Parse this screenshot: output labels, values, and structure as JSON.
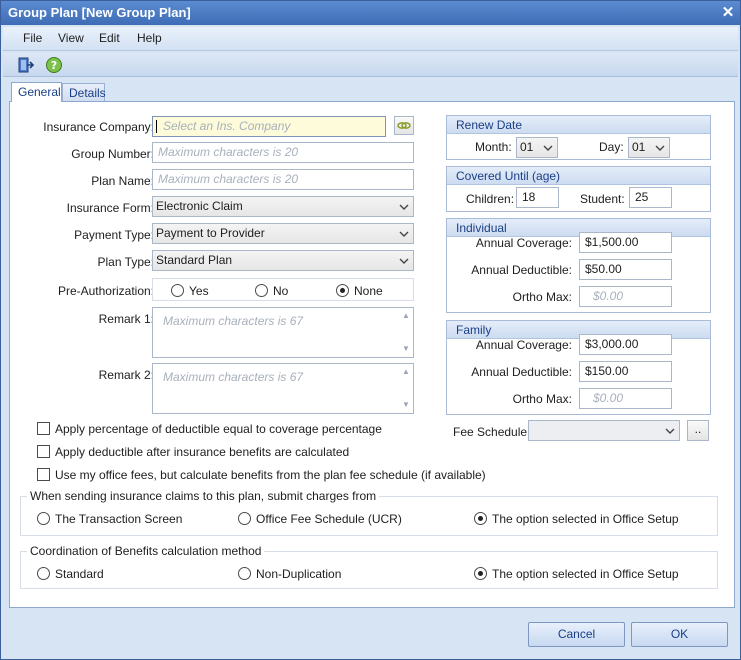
{
  "window": {
    "title": "Group Plan [New Group Plan]"
  },
  "menu": [
    "File",
    "View",
    "Edit",
    "Help"
  ],
  "tabs": [
    "General",
    "Details"
  ],
  "fields": {
    "insurance_company": {
      "label": "Insurance Company:",
      "placeholder": "Select an Ins. Company"
    },
    "group_number": {
      "label": "Group Number:",
      "placeholder": "Maximum characters is 20"
    },
    "plan_name": {
      "label": "Plan Name:",
      "placeholder": "Maximum characters is 20"
    },
    "insurance_form": {
      "label": "Insurance Form:",
      "value": "Electronic Claim"
    },
    "payment_type": {
      "label": "Payment Type:",
      "value": "Payment to Provider"
    },
    "plan_type": {
      "label": "Plan Type:",
      "value": "Standard Plan"
    },
    "pre_authorization": {
      "label": "Pre-Authorization:",
      "options": [
        "Yes",
        "No",
        "None"
      ],
      "selected": "None"
    },
    "remark1": {
      "label": "Remark 1:",
      "placeholder": "Maximum characters is 67"
    },
    "remark2": {
      "label": "Remark 2:",
      "placeholder": "Maximum characters is 67"
    }
  },
  "checkboxes": [
    "Apply percentage of deductible equal to coverage percentage",
    "Apply deductible after insurance benefits are calculated",
    "Use my office fees, but calculate benefits from the plan fee schedule (if available)"
  ],
  "renew_date": {
    "title": "Renew Date",
    "month_label": "Month:",
    "month": "01",
    "day_label": "Day:",
    "day": "01"
  },
  "covered_until": {
    "title": "Covered Until (age)",
    "children_label": "Children:",
    "children": "18",
    "student_label": "Student:",
    "student": "25"
  },
  "individual": {
    "title": "Individual",
    "annual_coverage_label": "Annual Coverage:",
    "annual_coverage": "$1,500.00",
    "annual_deductible_label": "Annual Deductible:",
    "annual_deductible": "$50.00",
    "ortho_max_label": "Ortho Max:",
    "ortho_max_placeholder": "$0.00"
  },
  "family": {
    "title": "Family",
    "annual_coverage_label": "Annual Coverage:",
    "annual_coverage": "$3,000.00",
    "annual_deductible_label": "Annual Deductible:",
    "annual_deductible": "$150.00",
    "ortho_max_label": "Ortho Max:",
    "ortho_max_placeholder": "$0.00"
  },
  "fee_schedule": {
    "label": "Fee Schedule:",
    "value": "",
    "browse_label": ".."
  },
  "submit_charges": {
    "legend": "When sending insurance claims to this plan, submit charges from",
    "options": [
      "The Transaction Screen",
      "Office Fee Schedule (UCR)",
      "The option selected in Office Setup"
    ],
    "selected_index": 2
  },
  "cob": {
    "legend": "Coordination of Benefits calculation method",
    "options": [
      "Standard",
      "Non-Duplication",
      "The option selected in Office Setup"
    ],
    "selected_index": 2
  },
  "buttons": {
    "cancel": "Cancel",
    "ok": "OK"
  }
}
